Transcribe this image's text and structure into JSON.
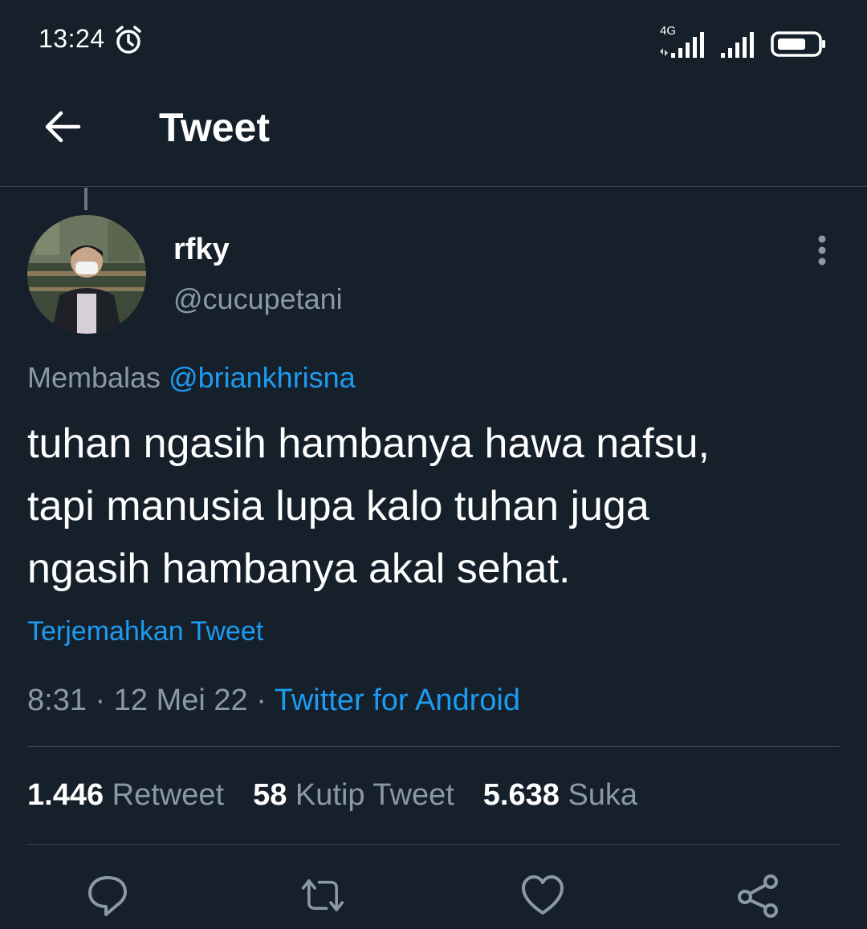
{
  "status_bar": {
    "time": "13:24",
    "network": "4G",
    "icons": [
      "alarm-icon",
      "signal-icon",
      "signal-icon",
      "battery-icon"
    ]
  },
  "header": {
    "title": "Tweet",
    "back_icon": "arrow-left-icon"
  },
  "tweet": {
    "author": {
      "display_name": "rfky",
      "handle": "@cucupetani"
    },
    "reply_label": "Membalas",
    "reply_mention": "@briankhrisna",
    "text_lines": [
      "tuhan ngasih hambanya hawa nafsu,",
      "tapi manusia lupa kalo tuhan juga",
      "ngasih hambanya akal sehat."
    ],
    "translate_label": "Terjemahkan Tweet",
    "time": "8:31",
    "separator": "·",
    "date": "12 Mei 22",
    "source": "Twitter for Android",
    "stats": {
      "retweets_count": "1.446",
      "retweets_label": "Retweet",
      "quotes_count": "58",
      "quotes_label": "Kutip Tweet",
      "likes_count": "5.638",
      "likes_label": "Suka"
    },
    "actions": [
      "reply-icon",
      "retweet-icon",
      "like-icon",
      "share-icon"
    ]
  },
  "colors": {
    "background": "#15202b",
    "accent": "#1d9bf0",
    "secondary_text": "#8b98a5",
    "divider": "#38444d"
  }
}
